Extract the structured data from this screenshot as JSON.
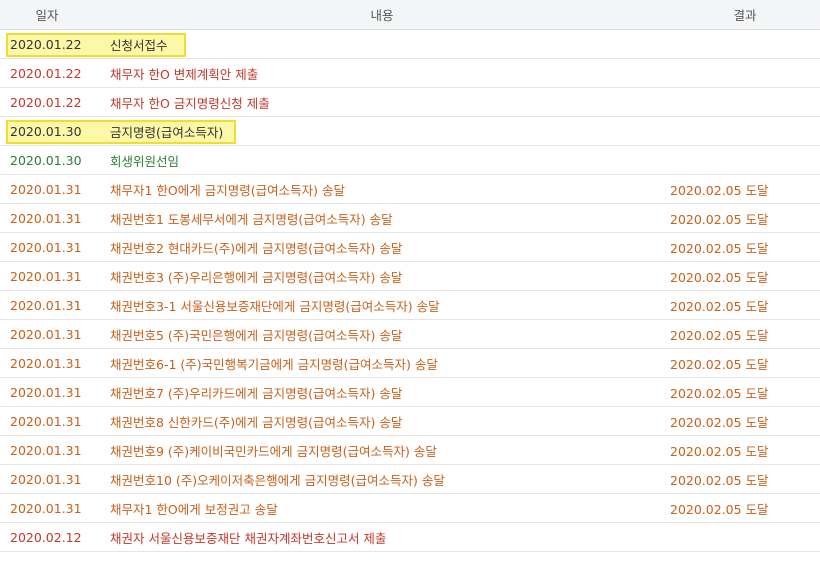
{
  "colors": {
    "default": "#333333",
    "red": "#c0392b",
    "green": "#2e7d32",
    "orange": "#c8611b",
    "highlight": "#fdf8a8"
  },
  "header": {
    "date": "일자",
    "content": "내용",
    "result": "결과"
  },
  "rows": [
    {
      "date": "2020.01.22",
      "content": "신청서접수",
      "result": "",
      "color": "default",
      "highlight": true
    },
    {
      "date": "2020.01.22",
      "content": "채무자 한O 변제계획안 제출",
      "result": "",
      "color": "red",
      "highlight": false
    },
    {
      "date": "2020.01.22",
      "content": "채무자 한O 금지명령신청 제출",
      "result": "",
      "color": "red",
      "highlight": false
    },
    {
      "date": "2020.01.30",
      "content": "금지명령(급여소득자)",
      "result": "",
      "color": "default",
      "highlight": true
    },
    {
      "date": "2020.01.30",
      "content": "회생위원선임",
      "result": "",
      "color": "green",
      "highlight": false
    },
    {
      "date": "2020.01.31",
      "content": "채무자1 한O에게 금지명령(급여소득자) 송달",
      "result": "2020.02.05 도달",
      "color": "orange",
      "highlight": false
    },
    {
      "date": "2020.01.31",
      "content": "채권번호1 도봉세무서에게 금지명령(급여소득자) 송달",
      "result": "2020.02.05 도달",
      "color": "orange",
      "highlight": false
    },
    {
      "date": "2020.01.31",
      "content": "채권번호2 현대카드(주)에게 금지명령(급여소득자) 송달",
      "result": "2020.02.05 도달",
      "color": "orange",
      "highlight": false
    },
    {
      "date": "2020.01.31",
      "content": "채권번호3 (주)우리은행에게 금지명령(급여소득자) 송달",
      "result": "2020.02.05 도달",
      "color": "orange",
      "highlight": false
    },
    {
      "date": "2020.01.31",
      "content": "채권번호3-1 서울신용보증재단에게 금지명령(급여소득자) 송달",
      "result": "2020.02.05 도달",
      "color": "orange",
      "highlight": false
    },
    {
      "date": "2020.01.31",
      "content": "채권번호5 (주)국민은행에게 금지명령(급여소득자) 송달",
      "result": "2020.02.05 도달",
      "color": "orange",
      "highlight": false
    },
    {
      "date": "2020.01.31",
      "content": "채권번호6-1 (주)국민행복기금에게 금지명령(급여소득자) 송달",
      "result": "2020.02.05 도달",
      "color": "orange",
      "highlight": false
    },
    {
      "date": "2020.01.31",
      "content": "채권번호7 (주)우리카드에게 금지명령(급여소득자) 송달",
      "result": "2020.02.05 도달",
      "color": "orange",
      "highlight": false
    },
    {
      "date": "2020.01.31",
      "content": "채권번호8 신한카드(주)에게 금지명령(급여소득자) 송달",
      "result": "2020.02.05 도달",
      "color": "orange",
      "highlight": false
    },
    {
      "date": "2020.01.31",
      "content": "채권번호9 (주)케이비국민카드에게 금지명령(급여소득자) 송달",
      "result": "2020.02.05 도달",
      "color": "orange",
      "highlight": false
    },
    {
      "date": "2020.01.31",
      "content": "채권번호10 (주)오케이저축은행에게 금지명령(급여소득자) 송달",
      "result": "2020.02.05 도달",
      "color": "orange",
      "highlight": false
    },
    {
      "date": "2020.01.31",
      "content": "채무자1 한O에게 보정권고 송달",
      "result": "2020.02.05 도달",
      "color": "orange",
      "highlight": false
    },
    {
      "date": "2020.02.12",
      "content": "채권자 서울신용보증재단 채권자계좌번호신고서 제출",
      "result": "",
      "color": "red",
      "highlight": false
    }
  ]
}
